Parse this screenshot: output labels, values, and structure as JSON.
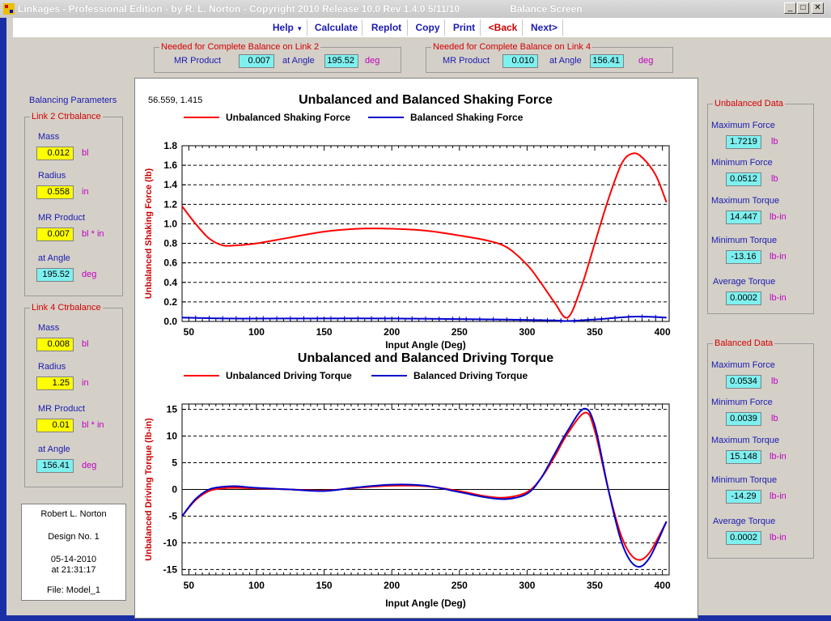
{
  "window": {
    "title": "Linkages - Professional Edition - by R. L. Norton - Copyright 2010   Release 10.0   Rev 1.4.0   5/11/10",
    "screen_name": "Balance Screen"
  },
  "toolbar": {
    "help": "Help",
    "calculate": "Calculate",
    "replot": "Replot",
    "copy": "Copy",
    "print": "Print",
    "back": "<Back",
    "next": "Next>"
  },
  "needed_link2": {
    "title": "Needed for Complete Balance on Link 2",
    "mr_label": "MR Product",
    "mr_value": "0.007",
    "angle_label": "at Angle",
    "angle_value": "195.52",
    "angle_unit": "deg"
  },
  "needed_link4": {
    "title": "Needed for Complete Balance on Link 4",
    "mr_label": "MR Product",
    "mr_value": "0.010",
    "angle_label": "at Angle",
    "angle_value": "156.41",
    "angle_unit": "deg"
  },
  "balancing": {
    "heading": "Balancing Parameters",
    "link2": {
      "title": "Link 2 Ctrbalance",
      "mass_label": "Mass",
      "mass_value": "0.012",
      "mass_unit": "bl",
      "radius_label": "Radius",
      "radius_value": "0.558",
      "radius_unit": "in",
      "mr_label": "MR Product",
      "mr_value": "0.007",
      "mr_unit": "bl * in",
      "angle_label": "at Angle",
      "angle_value": "195.52",
      "angle_unit": "deg"
    },
    "link4": {
      "title": "Link 4 Ctrbalance",
      "mass_label": "Mass",
      "mass_value": "0.008",
      "mass_unit": "bl",
      "radius_label": "Radius",
      "radius_value": "1.25",
      "radius_unit": "in",
      "mr_label": "MR Product",
      "mr_value": "0.01",
      "mr_unit": "bl * in",
      "angle_label": "at Angle",
      "angle_value": "156.41",
      "angle_unit": "deg"
    }
  },
  "info": {
    "author": "Robert L. Norton",
    "design": "Design No. 1",
    "date": "05-14-2010",
    "time": "at 21:31:17",
    "file": "File: Model_1"
  },
  "cursor_readout": "56.559, 1.415",
  "unbalanced_data": {
    "title": "Unbalanced Data",
    "max_force_label": "Maximum Force",
    "max_force": "1.7219",
    "force_unit": "lb",
    "min_force_label": "Minimum Force",
    "min_force": "0.0512",
    "max_torque_label": "Maximum Torque",
    "max_torque": "14.447",
    "torque_unit": "lb-in",
    "min_torque_label": "Minimum Torque",
    "min_torque": "-13.16",
    "avg_torque_label": "Average Torque",
    "avg_torque": "0.0002"
  },
  "balanced_data": {
    "title": "Balanced Data",
    "max_force_label": "Maximum Force",
    "max_force": "0.0534",
    "force_unit": "lb",
    "min_force_label": "Minimum Force",
    "min_force": "0.0039",
    "max_torque_label": "Maximum Torque",
    "max_torque": "15.148",
    "torque_unit": "lb-in",
    "min_torque_label": "Minimum Torque",
    "min_torque": "-14.29",
    "avg_torque_label": "Average Torque",
    "avg_torque": "0.0002"
  },
  "chart_data": [
    {
      "type": "line",
      "title": "Unbalanced and Balanced Shaking Force",
      "xlabel": "Input Angle (Deg)",
      "ylabel": "Unbalanced Shaking Force  (lb)",
      "xlim": [
        45,
        405
      ],
      "ylim": [
        0,
        1.8
      ],
      "xticks": [
        50,
        100,
        150,
        200,
        250,
        300,
        350,
        400
      ],
      "yticks": [
        0.0,
        0.2,
        0.4,
        0.6,
        0.8,
        1.0,
        1.2,
        1.4,
        1.6,
        1.8
      ],
      "ytick_labels": [
        "0.0",
        "0.2",
        "0.4",
        "0.6",
        "0.8",
        "1.0",
        "1.2",
        "1.4",
        "1.6",
        "1.8"
      ],
      "grid": "horizontal dashed",
      "legend": "top",
      "series": [
        {
          "name": "Unbalanced Shaking Force",
          "color": "#ff0000",
          "x": [
            45,
            55,
            65,
            75,
            85,
            100,
            125,
            150,
            175,
            200,
            225,
            250,
            270,
            285,
            300,
            310,
            320,
            330,
            340,
            350,
            360,
            370,
            378,
            385,
            395,
            403
          ],
          "y": [
            1.18,
            1.0,
            0.85,
            0.78,
            0.78,
            0.8,
            0.86,
            0.92,
            0.95,
            0.95,
            0.93,
            0.88,
            0.83,
            0.76,
            0.58,
            0.4,
            0.2,
            0.04,
            0.35,
            0.8,
            1.25,
            1.62,
            1.72,
            1.68,
            1.5,
            1.22
          ]
        },
        {
          "name": "Balanced Shaking Force",
          "color": "#0000cc",
          "x": [
            45,
            80,
            120,
            200,
            280,
            320,
            330,
            350,
            380,
            403
          ],
          "y": [
            0.04,
            0.03,
            0.03,
            0.03,
            0.02,
            0.01,
            0.004,
            0.02,
            0.05,
            0.04
          ]
        }
      ]
    },
    {
      "type": "line",
      "title": "Unbalanced and Balanced Driving Torque",
      "xlabel": "Input Angle (Deg)",
      "ylabel": "Unbalanced Driving Torque  (lb-in)",
      "xlim": [
        45,
        405
      ],
      "ylim": [
        -16,
        16
      ],
      "xticks": [
        50,
        100,
        150,
        200,
        250,
        300,
        350,
        400
      ],
      "yticks": [
        -15,
        -10,
        -5,
        0,
        5,
        10,
        15
      ],
      "grid": "horizontal dashed",
      "legend": "top",
      "series": [
        {
          "name": "Unbalanced Driving Torque",
          "color": "#ff0000",
          "x": [
            45,
            55,
            65,
            75,
            85,
            100,
            125,
            150,
            175,
            200,
            225,
            250,
            270,
            285,
            300,
            310,
            320,
            330,
            343,
            350,
            360,
            370,
            380,
            390,
            403
          ],
          "y": [
            -5.0,
            -2.0,
            -0.3,
            0.2,
            0.3,
            0.2,
            0.0,
            -0.2,
            0.3,
            0.7,
            0.6,
            -0.3,
            -1.3,
            -1.5,
            -0.5,
            2.0,
            6.0,
            10.5,
            14.4,
            11.0,
            0.0,
            -9.0,
            -13.0,
            -12.0,
            -6.0
          ]
        },
        {
          "name": "Balanced Driving Torque",
          "color": "#0000cc",
          "x": [
            45,
            55,
            65,
            75,
            85,
            100,
            125,
            150,
            175,
            200,
            225,
            250,
            270,
            285,
            300,
            310,
            320,
            330,
            342,
            350,
            360,
            370,
            380,
            390,
            403
          ],
          "y": [
            -5.0,
            -1.8,
            0.0,
            0.5,
            0.6,
            0.3,
            0.0,
            -0.3,
            0.4,
            0.9,
            0.7,
            -0.5,
            -1.5,
            -1.8,
            -0.8,
            2.0,
            6.5,
            11.0,
            15.1,
            12.0,
            0.0,
            -10.0,
            -14.3,
            -13.0,
            -6.0
          ]
        }
      ]
    }
  ]
}
